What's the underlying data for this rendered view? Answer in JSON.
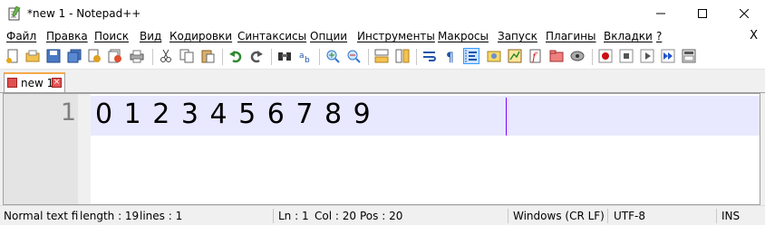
{
  "window": {
    "title": "*new 1 - Notepad++",
    "minimize_icon": "minimize-icon",
    "maximize_icon": "maximize-icon",
    "close_icon": "close-icon"
  },
  "menu": {
    "items": [
      "Файл",
      "Правка",
      "Поиск",
      "Вид",
      "Кодировки",
      "Синтаксисы",
      "Опции",
      "Инструменты",
      "Макросы",
      "Запуск",
      "Плагины",
      "Вкладки",
      "?"
    ],
    "close_label": "X"
  },
  "toolbar": {
    "icons": [
      "new-file-icon",
      "open-file-icon",
      "save-icon",
      "save-all-icon",
      "close-icon",
      "close-all-icon",
      "print-icon",
      "cut-icon",
      "copy-icon",
      "paste-icon",
      "undo-icon",
      "redo-icon",
      "find-icon",
      "replace-icon",
      "zoom-in-icon",
      "zoom-out-icon",
      "sync-vertical-icon",
      "sync-horizontal-icon",
      "word-wrap-icon",
      "show-all-chars-icon",
      "indent-guide-icon",
      "user-defined-language-icon",
      "document-map-icon",
      "function-list-icon",
      "folder-as-workspace-icon",
      "monitoring-icon",
      "record-macro-icon",
      "stop-recording-icon",
      "playback-macro-icon",
      "run-macro-multiple-icon",
      "save-macro-icon"
    ],
    "active_icon": "indent-guide-icon"
  },
  "tabs": [
    {
      "label": "new 1",
      "close_glyph": "×",
      "modified": true
    }
  ],
  "editor": {
    "line_number": "1",
    "line_text": "0 1 2 3 4 5 6 7 8 9",
    "current_line_color": "#e8e8ff",
    "caret_color": "#8000ff"
  },
  "status": {
    "file_type": "Normal text file",
    "length": "length : 19",
    "lines": "lines : 1",
    "ln": "Ln : 1",
    "col": "Col : 20",
    "pos": "Pos : 20",
    "eol": "Windows (CR LF)",
    "encoding": "UTF-8",
    "mode": "INS"
  },
  "colors": {
    "tab_accent": "#f7a84a",
    "active_toolbar": "#3399ff"
  }
}
